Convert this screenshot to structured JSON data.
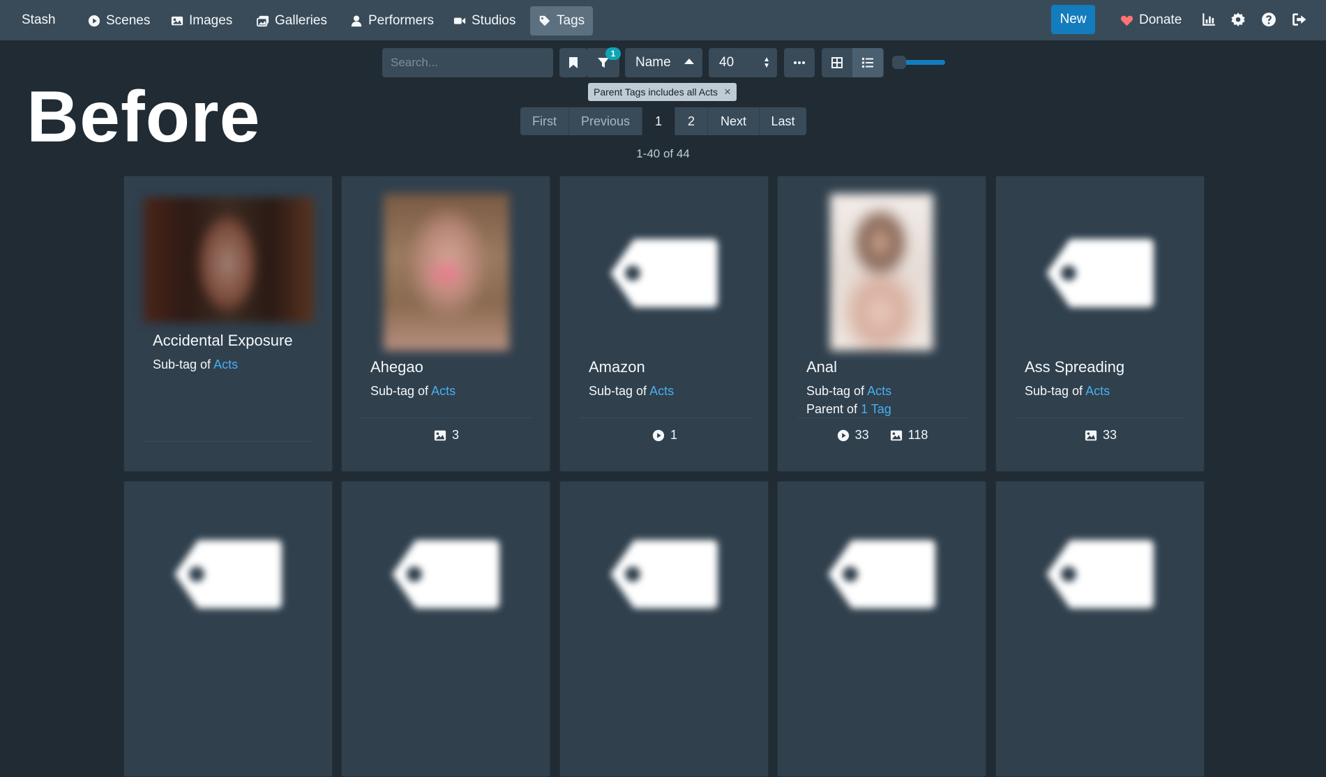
{
  "nav": {
    "brand": "Stash",
    "items": [
      {
        "label": "Scenes",
        "icon": "play-circle-icon"
      },
      {
        "label": "Images",
        "icon": "image-icon"
      },
      {
        "label": "Galleries",
        "icon": "images-icon"
      },
      {
        "label": "Performers",
        "icon": "user-icon"
      },
      {
        "label": "Studios",
        "icon": "video-icon"
      },
      {
        "label": "Tags",
        "icon": "tag-icon",
        "active": true
      }
    ],
    "new_label": "New",
    "donate_label": "Donate",
    "icons": [
      "stats-icon",
      "settings-icon",
      "help-icon",
      "logout-icon"
    ]
  },
  "toolbar": {
    "search_placeholder": "Search...",
    "filter_count": "1",
    "sort_by": "Name",
    "per_page": "40",
    "zoom_level": 0.0
  },
  "filter_tag": {
    "label": "Parent Tags includes all Acts"
  },
  "overlay_text": "Before",
  "pagination": {
    "first": "First",
    "previous": "Previous",
    "pages": [
      "1",
      "2"
    ],
    "current": "1",
    "next": "Next",
    "last": "Last",
    "summary": "1-40 of 44"
  },
  "cards": [
    {
      "name": "Accidental Exposure",
      "sub_prefix": "Sub-tag of",
      "parent": "Acts"
    },
    {
      "name": "Ahegao",
      "sub_prefix": "Sub-tag of",
      "parent": "Acts",
      "images": "3"
    },
    {
      "name": "Amazon",
      "sub_prefix": "Sub-tag of",
      "parent": "Acts",
      "scenes": "1"
    },
    {
      "name": "Anal",
      "sub_prefix": "Sub-tag of",
      "parent": "Acts",
      "parent_of_prefix": "Parent of",
      "children": "1 Tag",
      "scenes": "33",
      "images": "118"
    },
    {
      "name": "Ass Spreading",
      "sub_prefix": "Sub-tag of",
      "parent": "Acts",
      "images": "33"
    }
  ],
  "colors": {
    "background": "#202b33",
    "navbar": "#394b59",
    "card": "#30404d",
    "accent": "#137cbd",
    "link": "#48aff0",
    "badge": "#0ea5b5",
    "donate_heart": "#ff7373"
  }
}
